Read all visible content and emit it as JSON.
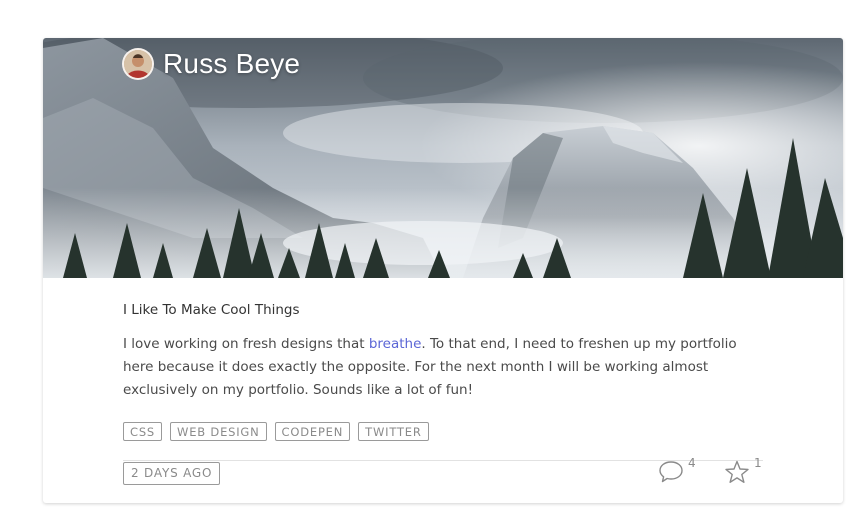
{
  "author": {
    "name": "Russ Beye"
  },
  "post": {
    "title": "I Like To Make Cool Things",
    "description_before": "I love working on fresh designs that ",
    "description_link": "breathe",
    "description_after": ". To that end, I need to freshen up my portfolio here because it does exactly the opposite. For the next month I will be working almost exclusively on my portfolio. Sounds like a lot of fun!"
  },
  "tags": [
    "CSS",
    "WEB DESIGN",
    "CODEPEN",
    "TWITTER"
  ],
  "meta": {
    "time_ago": "2 DAYS AGO",
    "comments_count": "4",
    "stars_count": "1"
  },
  "icons": {
    "comments": "speech-bubble-icon",
    "stars": "star-outline-icon"
  },
  "colors": {
    "link": "#5b66d6",
    "tag_text": "#8a8a8a"
  }
}
